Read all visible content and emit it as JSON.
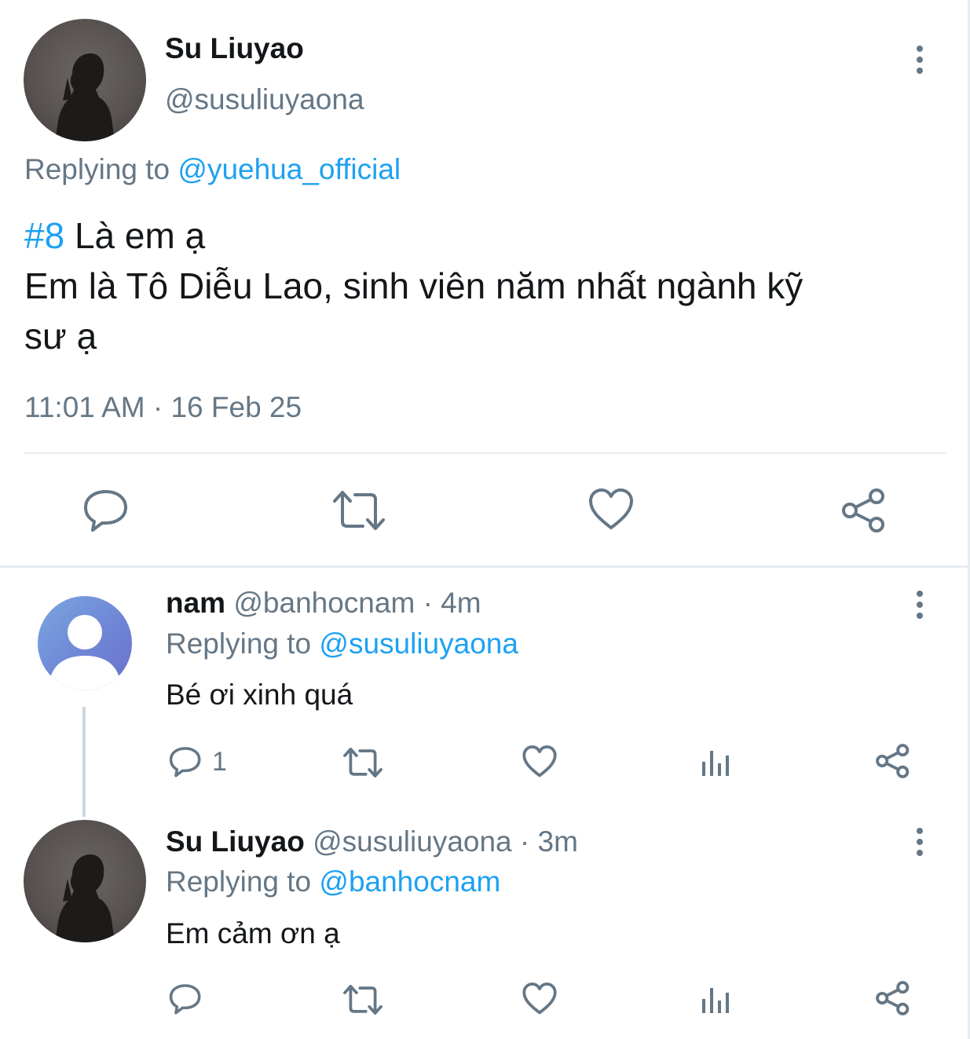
{
  "main_tweet": {
    "display_name": "Su Liuyao",
    "handle": "@susuliuyaona",
    "replying_prefix": "Replying to",
    "replying_to": "@yuehua_official",
    "hashtag": "#8",
    "text_line1_rest": " Là em ạ",
    "text_line2": "Em là Tô Diễu Lao, sinh viên năm nhất ngành kỹ",
    "text_line3": "sư ạ",
    "timestamp": "11:01 AM · 16 Feb 25"
  },
  "replies": [
    {
      "display_name": "nam",
      "handle": "@banhocnam",
      "time": "· 4m",
      "replying_prefix": "Replying to",
      "replying_to": "@susuliuyaona",
      "text": "Bé ơi xinh quá",
      "reply_count": "1"
    },
    {
      "display_name": "Su Liuyao",
      "handle": "@susuliuyaona",
      "time": "· 3m",
      "replying_prefix": "Replying to",
      "replying_to": "@banhocnam",
      "text": "Em cảm ơn ạ"
    }
  ],
  "icons": {
    "reply": "reply-icon",
    "retweet": "retweet-icon",
    "like": "heart-icon",
    "share": "share-icon",
    "stats": "analytics-icon",
    "more": "more-vertical-icon"
  },
  "colors": {
    "accent": "#1da1f2",
    "muted": "#657786",
    "text": "#14171a",
    "divider": "#e6ecf0"
  }
}
